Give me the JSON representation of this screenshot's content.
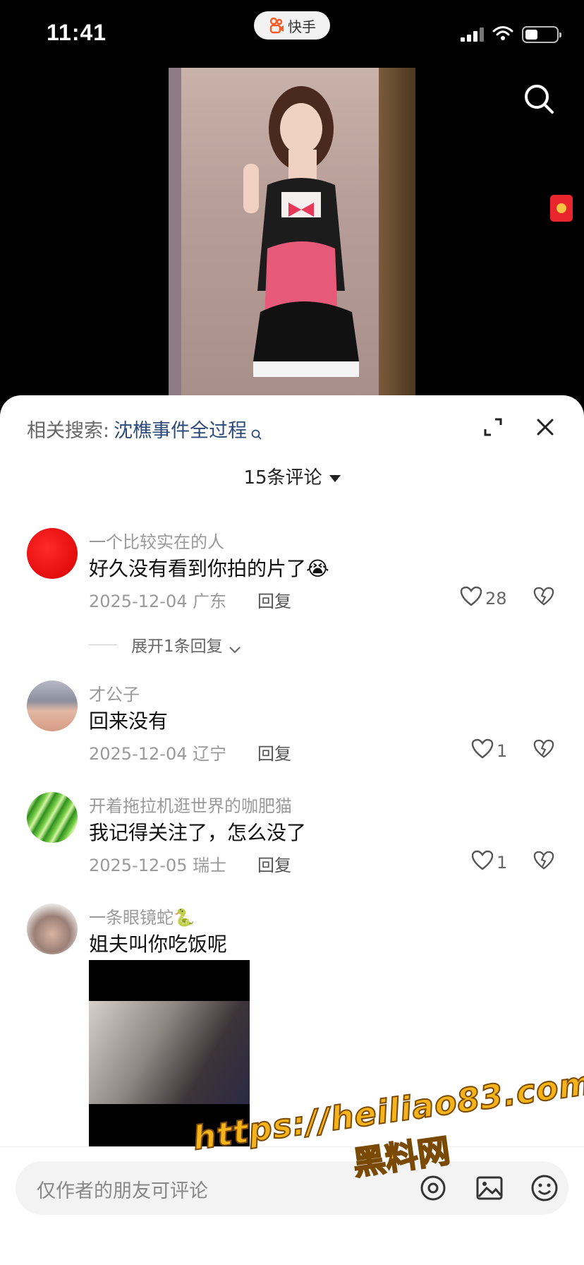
{
  "status_bar": {
    "time": "11:41",
    "app_name": "快手"
  },
  "related_search": {
    "label": "相关搜索:",
    "term": "沈樵事件全过程"
  },
  "comments_header": {
    "count_label": "15条评论"
  },
  "comments": [
    {
      "name": "一个比较实在的人",
      "text": "好久没有看到你拍的片了😭",
      "meta": "2025-12-04 广东",
      "reply": "回复",
      "likes": "28",
      "expand": "展开1条回复"
    },
    {
      "name": "才公子",
      "text": "回来没有",
      "meta": "2025-12-04 辽宁",
      "reply": "回复",
      "likes": "1"
    },
    {
      "name": "开着拖拉机逛世界的咖肥猫",
      "text": "我记得关注了，怎么没了",
      "meta": "2025-12-05 瑞士",
      "reply": "回复",
      "likes": "1"
    },
    {
      "name": "一条眼镜蛇🐍",
      "text": "姐夫叫你吃饭呢"
    }
  ],
  "input": {
    "placeholder": "仅作者的朋友可评论"
  },
  "watermark": {
    "url": "https://heiliao83.com",
    "text": "黑料网"
  },
  "colors": {
    "accent_link": "#2d4a7a",
    "watermark": "#f4b21b",
    "red_packet": "#e8262b"
  }
}
